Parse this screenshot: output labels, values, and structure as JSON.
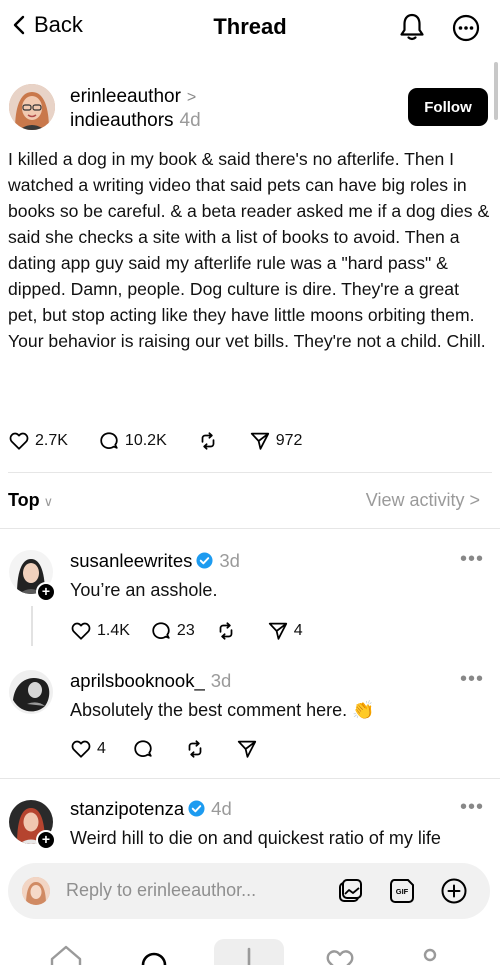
{
  "header": {
    "back_label": "Back",
    "title": "Thread"
  },
  "post": {
    "username": "erinleeauthor",
    "community": "indieauthors",
    "time": "4d",
    "follow_label": "Follow",
    "text": "I killed a dog in my book & said there's no afterlife. Then I watched a writing video that said pets can have big roles in books so be careful. & a beta reader asked me if a dog dies & said she checks a site with a list of books to avoid. Then a dating app guy said my afterlife rule was a \"hard pass\" & dipped. Damn, people. Dog culture is dire. They're a great pet, but stop acting like they have little moons orbiting them. Your behavior is raising our vet bills. They're not a child. Chill.",
    "likes": "2.7K",
    "comments": "10.2K",
    "shares": "972"
  },
  "sort": {
    "label": "Top",
    "view_activity": "View activity"
  },
  "replies": [
    {
      "username": "susanleewrites",
      "time": "3d",
      "verified": true,
      "text": "You’re an asshole.",
      "likes": "1.4K",
      "comments": "23",
      "shares": "4"
    },
    {
      "username": "aprilsbooknook_",
      "time": "3d",
      "verified": false,
      "text": "Absolutely the best comment here.",
      "emoji": "👏",
      "likes": "4"
    },
    {
      "username": "stanzipotenza",
      "time": "4d",
      "verified": true,
      "text": "Weird hill to die on and quickest ratio of my life"
    }
  ],
  "composer": {
    "placeholder": "Reply to erinleeauthor..."
  },
  "colors": {
    "verified_blue": "#1d9bf0",
    "muted_gray": "#9a9a9a"
  }
}
